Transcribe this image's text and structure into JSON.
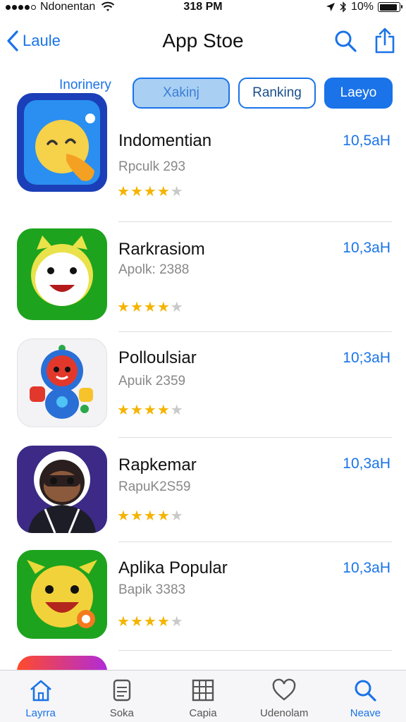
{
  "status_bar": {
    "carrier": "Ndonentan",
    "time": "318 PM",
    "battery": "10%",
    "battery_level": 0.9
  },
  "nav": {
    "back_label": "Laule",
    "title": "App Stoe"
  },
  "segments": {
    "label": "Inorinery",
    "options": [
      "Xakinj",
      "Ranking",
      "Laeyo"
    ],
    "selected_index": 2
  },
  "apps": [
    {
      "name": "Indomentian",
      "subtitle": "Rpculk 293",
      "size": "10,5aH",
      "rating": 4,
      "icon": "blue-bird-icon"
    },
    {
      "name": "Rarkrasiom",
      "subtitle": "Apolk: 2388",
      "size": "10,3aH",
      "rating": 4,
      "icon": "green-owl-icon"
    },
    {
      "name": "Polloulsiar",
      "subtitle": "Apuik 2359",
      "size": "10;3aH",
      "rating": 4,
      "icon": "robot-toy-icon"
    },
    {
      "name": "Rapkemar",
      "subtitle": "RapuK2S59",
      "size": "10,3aH",
      "rating": 4,
      "icon": "ninja-icon"
    },
    {
      "name": "Aplika Popular",
      "subtitle": "Bapik 3383",
      "size": "10,3aH",
      "rating": 4,
      "icon": "smiley-monster-icon"
    }
  ],
  "tabs": [
    {
      "label": "Layrra",
      "icon": "home-icon"
    },
    {
      "label": "Soka",
      "icon": "document-icon"
    },
    {
      "label": "Capia",
      "icon": "grid-icon"
    },
    {
      "label": "Udenolam",
      "icon": "heart-icon"
    },
    {
      "label": "Neave",
      "icon": "search-icon"
    }
  ],
  "active_tab_index": 4,
  "colors": {
    "accent": "#1a73e8",
    "star": "#f4b400",
    "star_off": "#c9c9c9"
  }
}
